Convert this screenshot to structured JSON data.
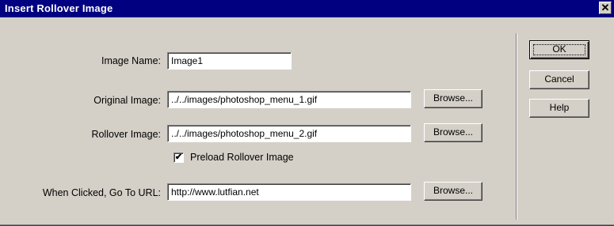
{
  "window": {
    "title": "Insert Rollover Image",
    "close_glyph": "✕"
  },
  "form": {
    "image_name": {
      "label": "Image Name:",
      "value": "Image1"
    },
    "original_image": {
      "label": "Original Image:",
      "value": "../../images/photoshop_menu_1.gif",
      "browse_label": "Browse..."
    },
    "rollover_image": {
      "label": "Rollover Image:",
      "value": "../../images/photoshop_menu_2.gif",
      "browse_label": "Browse..."
    },
    "preload": {
      "label": "Preload Rollover Image",
      "checked": true,
      "check_glyph": "✔"
    },
    "url": {
      "label": "When Clicked, Go To URL:",
      "value": "http://www.lutfian.net",
      "browse_label": "Browse..."
    }
  },
  "buttons": {
    "ok": "OK",
    "cancel": "Cancel",
    "help": "Help"
  }
}
